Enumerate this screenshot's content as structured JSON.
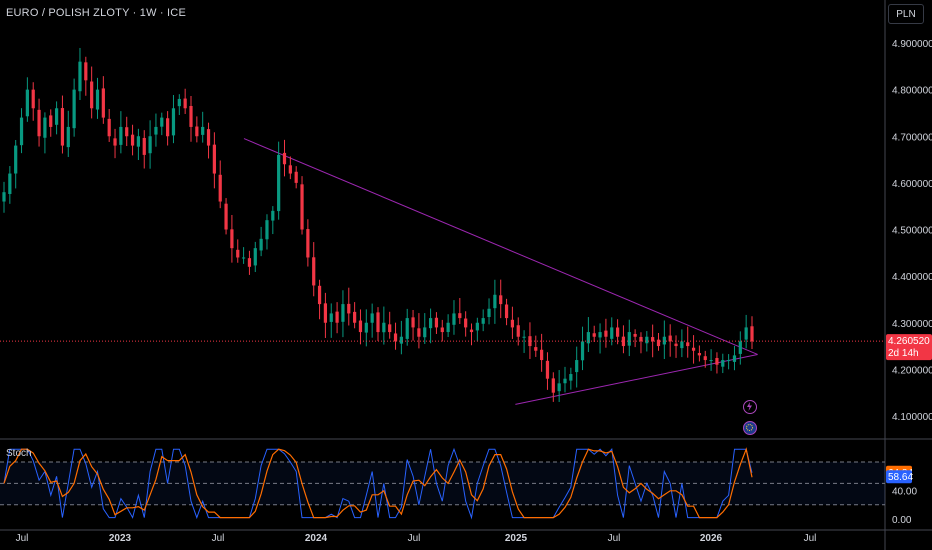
{
  "header": {
    "title": "EURO / POLISH ZLOTY · 1W · ICE",
    "currency": "PLN"
  },
  "indicator": {
    "name": "Stoch"
  },
  "colors": {
    "up": "#089981",
    "down": "#f23645",
    "triangle": "#9c27b0",
    "k_line": "#2962ff",
    "d_line": "#ff6d00",
    "price_badge": "#f23645",
    "k_badge": "#2962ff",
    "d_badge": "#ff6d00"
  },
  "icons": {
    "flash": "lightning-icon",
    "flag": "eu-flag-icon"
  },
  "chart_data": {
    "type": "candlestick",
    "price_scale": {
      "min": 4.06,
      "max": 4.95,
      "ticks": [
        "4.900000",
        "4.800000",
        "4.700000",
        "4.600000",
        "4.500000",
        "4.400000",
        "4.300000",
        "4.200000",
        "4.100000"
      ],
      "tick_values": [
        4.9,
        4.8,
        4.7,
        4.6,
        4.5,
        4.4,
        4.3,
        4.2,
        4.1
      ]
    },
    "time_axis": {
      "labels": [
        "Jul",
        "2023",
        "Jul",
        "2024",
        "Jul",
        "2025",
        "Jul",
        "2026",
        "Jul"
      ],
      "bold": [
        false,
        true,
        false,
        true,
        false,
        true,
        false,
        true,
        false
      ]
    },
    "last_price": {
      "value": 4.26052,
      "label": "4.260520",
      "countdown": "2d 14h"
    },
    "close_series": [
      4.58,
      4.62,
      4.68,
      4.74,
      4.8,
      4.76,
      4.7,
      4.74,
      4.72,
      4.76,
      4.68,
      4.72,
      4.8,
      4.86,
      4.82,
      4.76,
      4.8,
      4.74,
      4.7,
      4.68,
      4.72,
      4.7,
      4.68,
      4.7,
      4.66,
      4.7,
      4.72,
      4.74,
      4.7,
      4.76,
      4.78,
      4.76,
      4.72,
      4.7,
      4.72,
      4.68,
      4.62,
      4.56,
      4.5,
      4.46,
      4.44,
      4.44,
      4.42,
      4.46,
      4.48,
      4.52,
      4.54,
      4.66,
      4.64,
      4.62,
      4.6,
      4.5,
      4.44,
      4.38,
      4.34,
      4.3,
      4.32,
      4.3,
      4.34,
      4.32,
      4.3,
      4.28,
      4.3,
      4.32,
      4.28,
      4.3,
      4.28,
      4.26,
      4.27,
      4.31,
      4.29,
      4.27,
      4.29,
      4.31,
      4.29,
      4.28,
      4.3,
      4.32,
      4.31,
      4.29,
      4.28,
      4.3,
      4.31,
      4.33,
      4.36,
      4.34,
      4.31,
      4.29,
      4.27,
      4.27,
      4.25,
      4.24,
      4.22,
      4.18,
      4.15,
      4.17,
      4.18,
      4.19,
      4.22,
      4.26,
      4.28,
      4.27,
      4.28,
      4.27,
      4.29,
      4.27,
      4.25,
      4.28,
      4.27,
      4.26,
      4.27,
      4.26,
      4.25,
      4.27,
      4.26,
      4.25,
      4.26,
      4.25,
      4.24,
      4.23,
      4.22,
      4.22,
      4.21,
      4.22,
      4.22,
      4.23,
      4.26,
      4.29,
      4.26
    ],
    "triangle": {
      "upper": {
        "start": [
          4.695,
          0.276
        ],
        "end": [
          4.232,
          0.857
        ]
      },
      "lower": {
        "start": [
          4.125,
          0.583
        ],
        "end": [
          4.232,
          0.857
        ]
      }
    },
    "stochastic": {
      "range": [
        0,
        100
      ],
      "levels": [
        80,
        50,
        20
      ],
      "axis_labels": [
        "40.00",
        "0.00"
      ],
      "axis_values": [
        40,
        0
      ],
      "k_value": 64.84,
      "d_value": 58.64,
      "k_label": "64.84",
      "d_label": "58.64"
    }
  }
}
